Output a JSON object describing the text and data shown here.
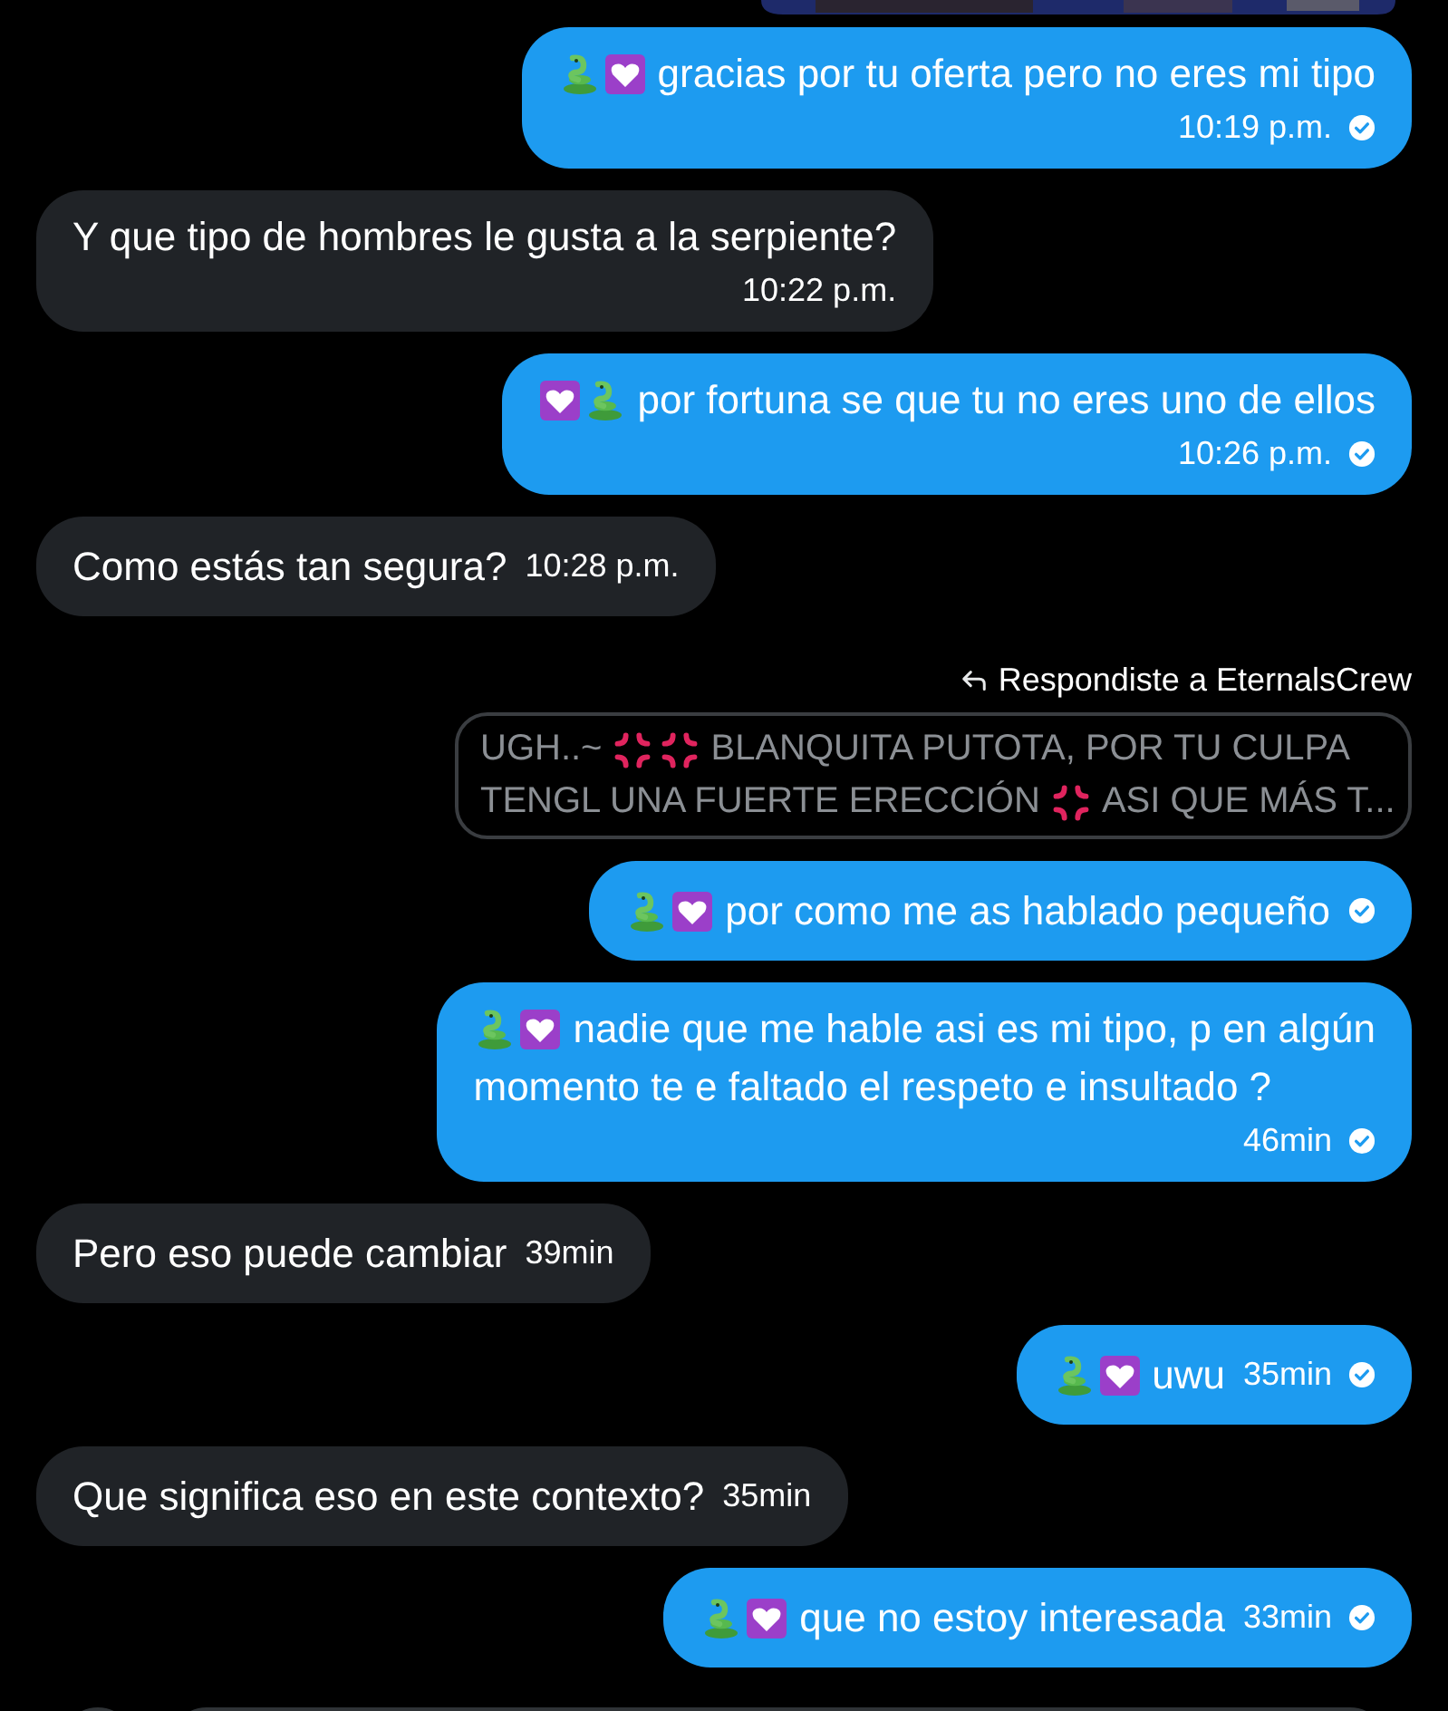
{
  "messages": [
    {
      "kind": "stacked",
      "outgoing": true,
      "icons": [
        {
          "kind": "snake"
        },
        {
          "kind": "heart"
        }
      ],
      "lines": [
        "gracias por tu oferta pero no eres mi tipo"
      ],
      "time": "10:19 p.m.",
      "seen": true
    },
    {
      "kind": "stacked",
      "outgoing": false,
      "lines": [
        "Y que tipo de hombres le gusta a la serpiente?"
      ],
      "time": "10:22 p.m."
    },
    {
      "kind": "stacked",
      "outgoing": true,
      "icons": [
        {
          "kind": "heart"
        },
        {
          "kind": "snake"
        }
      ],
      "lines": [
        "por fortuna se que tu no eres uno de ellos"
      ],
      "time": "10:26 p.m.",
      "seen": true
    },
    {
      "kind": "inline",
      "outgoing": false,
      "lines": [
        "Como estás tan segura?"
      ],
      "time": "10:28 p.m."
    },
    {
      "kind": "reply",
      "label": "Respondiste a EternalsCrew",
      "quote_lines": [
        {
          "segments": [
            {
              "kind": "text",
              "text": "UGH..~"
            },
            {
              "kind": "anger"
            },
            {
              "kind": "anger"
            },
            {
              "kind": "text",
              "text": "BLANQUITA PUTOTA, POR TU CULPA"
            }
          ]
        },
        {
          "segments": [
            {
              "kind": "text",
              "text": "TENGL UNA FUERTE ERECCIÓN"
            },
            {
              "kind": "anger"
            },
            {
              "kind": "text",
              "text": "ASI QUE MÁS T..."
            }
          ]
        }
      ]
    },
    {
      "kind": "inline",
      "outgoing": true,
      "icons": [
        {
          "kind": "snake"
        },
        {
          "kind": "heart"
        }
      ],
      "lines": [
        "por como me as hablado pequeño"
      ],
      "seen": true
    },
    {
      "kind": "stacked",
      "outgoing": true,
      "icons": [
        {
          "kind": "snake"
        },
        {
          "kind": "heart"
        }
      ],
      "lines": [
        "nadie que me hable asi es mi tipo, p en algún",
        "momento te e faltado el respeto e insultado ?"
      ],
      "time": "46min",
      "seen": true
    },
    {
      "kind": "inline",
      "outgoing": false,
      "lines": [
        "Pero eso puede cambiar"
      ],
      "time": "39min"
    },
    {
      "kind": "inline",
      "outgoing": true,
      "icons": [
        {
          "kind": "snake"
        },
        {
          "kind": "heart"
        }
      ],
      "lines": [
        "uwu"
      ],
      "time": "35min",
      "seen": true
    },
    {
      "kind": "inline",
      "outgoing": false,
      "lines": [
        "Que significa eso en este contexto?"
      ],
      "time": "35min"
    },
    {
      "kind": "inline",
      "outgoing": true,
      "icons": [
        {
          "kind": "snake"
        },
        {
          "kind": "heart"
        }
      ],
      "lines": [
        "que no estoy interesada"
      ],
      "time": "33min",
      "seen": true
    }
  ]
}
